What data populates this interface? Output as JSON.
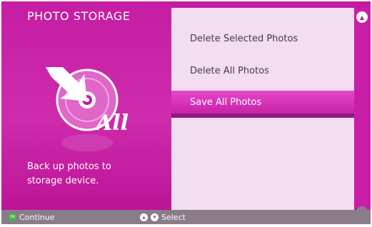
{
  "header": {
    "title": "PHOTO STORAGE"
  },
  "description": {
    "line1": "Back up photos to",
    "line2": "storage device."
  },
  "icon": {
    "name": "backup-all-icon",
    "caption": "All"
  },
  "menu": {
    "items": [
      {
        "label": "Delete Selected Photos",
        "selected": false
      },
      {
        "label": "Delete All Photos",
        "selected": false
      },
      {
        "label": "Save All Photos",
        "selected": true
      }
    ]
  },
  "footer": {
    "continue_label": "Continue",
    "select_label": "Select"
  },
  "colors": {
    "accent": "#c21aa0",
    "menu_bg": "#f4dcf1",
    "selected": "#e548c7",
    "footer": "#8a7c88",
    "ok_button": "#46b646"
  }
}
